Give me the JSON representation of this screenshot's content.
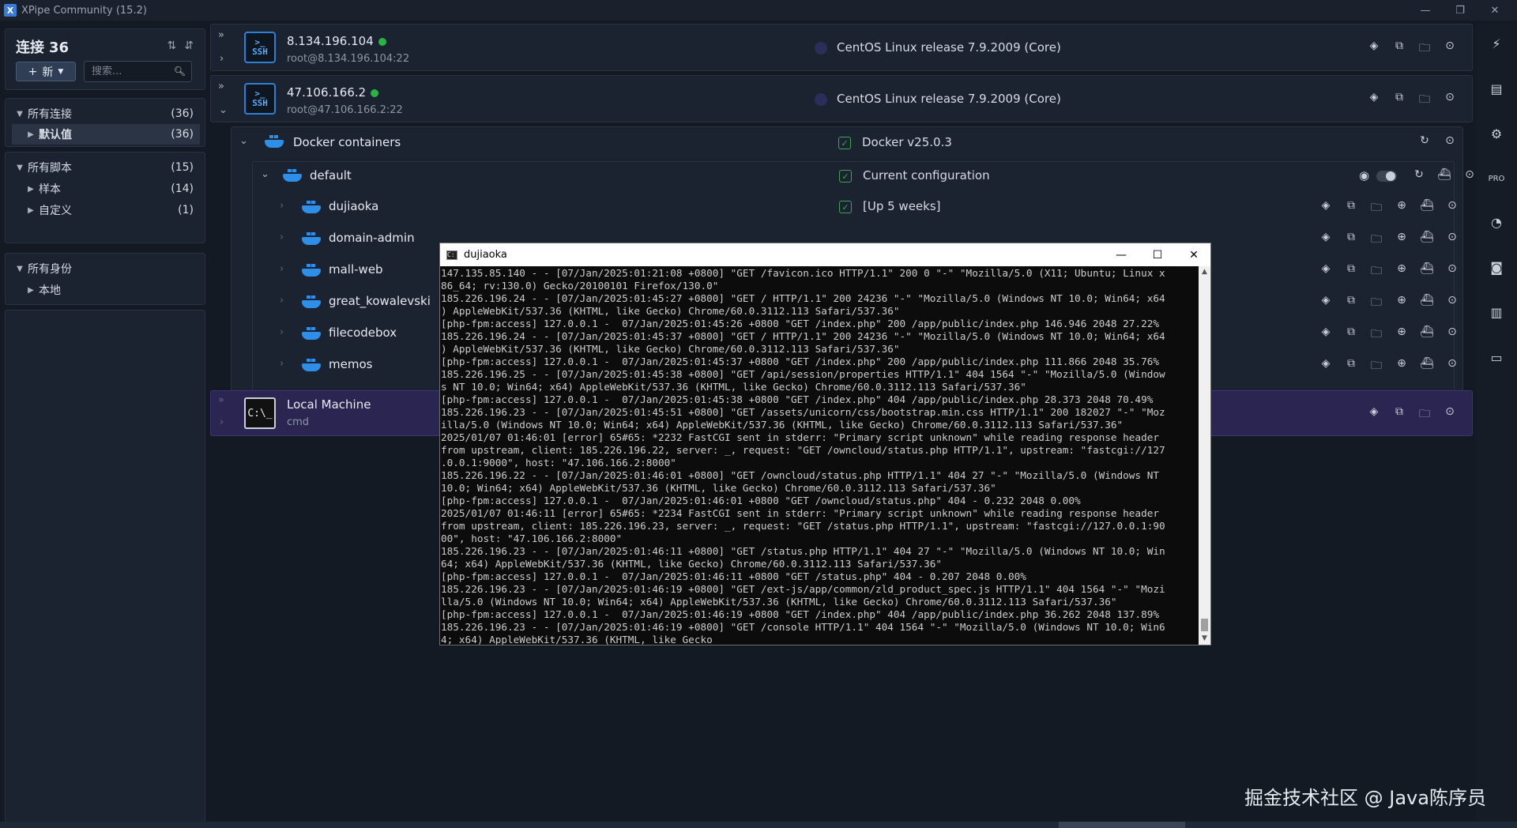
{
  "window": {
    "title": "XPipe Community (15.2)"
  },
  "sidebar": {
    "heading": "连接",
    "count": "36",
    "new_button": "新",
    "search_placeholder": "搜索...",
    "groups": [
      {
        "label": "所有连接",
        "count": "(36)",
        "children": [
          {
            "label": "默认值",
            "count": "(36)"
          }
        ]
      },
      {
        "label": "所有脚本",
        "count": "(15)",
        "children": [
          {
            "label": "样本",
            "count": "(14)"
          },
          {
            "label": "自定义",
            "count": "(1)"
          }
        ]
      },
      {
        "label": "所有身份",
        "count": "",
        "children": [
          {
            "label": "本地",
            "count": ""
          }
        ]
      }
    ]
  },
  "connections": {
    "host1": {
      "name": "8.134.196.104",
      "user": "root@8.134.196.104:22",
      "os": "CentOS Linux release 7.9.2009 (Core)"
    },
    "host2": {
      "name": "47.106.166.2",
      "user": "root@47.106.166.2:22",
      "os": "CentOS Linux release 7.9.2009 (Core)"
    },
    "docker": {
      "name": "Docker containers",
      "version": "Docker v25.0.3"
    },
    "default": {
      "name": "default",
      "status": "Current configuration"
    },
    "containers": [
      {
        "name": "dujiaoka",
        "status": "[Up 5 weeks]"
      },
      {
        "name": "domain-admin",
        "status": ""
      },
      {
        "name": "mall-web",
        "status": ""
      },
      {
        "name": "great_kowalevski",
        "status": ""
      },
      {
        "name": "filecodebox",
        "status": ""
      },
      {
        "name": "memos",
        "status": ""
      }
    ],
    "local": {
      "name": "Local Machine",
      "sub": "cmd"
    }
  },
  "terminal": {
    "title": "dujiaoka",
    "lines": [
      "147.135.85.140 - - [07/Jan/2025:01:21:08 +0800] \"GET /favicon.ico HTTP/1.1\" 200 0 \"-\" \"Mozilla/5.0 (X11; Ubuntu; Linux x",
      "86_64; rv:130.0) Gecko/20100101 Firefox/130.0\"",
      "185.226.196.24 - - [07/Jan/2025:01:45:27 +0800] \"GET / HTTP/1.1\" 200 24236 \"-\" \"Mozilla/5.0 (Windows NT 10.0; Win64; x64",
      ") AppleWebKit/537.36 (KHTML, like Gecko) Chrome/60.0.3112.113 Safari/537.36\"",
      "[php-fpm:access] 127.0.0.1 -  07/Jan/2025:01:45:26 +0800 \"GET /index.php\" 200 /app/public/index.php 146.946 2048 27.22%",
      "185.226.196.24 - - [07/Jan/2025:01:45:37 +0800] \"GET / HTTP/1.1\" 200 24236 \"-\" \"Mozilla/5.0 (Windows NT 10.0; Win64; x64",
      ") AppleWebKit/537.36 (KHTML, like Gecko) Chrome/60.0.3112.113 Safari/537.36\"",
      "[php-fpm:access] 127.0.0.1 -  07/Jan/2025:01:45:37 +0800 \"GET /index.php\" 200 /app/public/index.php 111.866 2048 35.76%",
      "185.226.196.25 - - [07/Jan/2025:01:45:38 +0800] \"GET /api/session/properties HTTP/1.1\" 404 1564 \"-\" \"Mozilla/5.0 (Window",
      "s NT 10.0; Win64; x64) AppleWebKit/537.36 (KHTML, like Gecko) Chrome/60.0.3112.113 Safari/537.36\"",
      "[php-fpm:access] 127.0.0.1 -  07/Jan/2025:01:45:38 +0800 \"GET /index.php\" 404 /app/public/index.php 28.373 2048 70.49%",
      "185.226.196.23 - - [07/Jan/2025:01:45:51 +0800] \"GET /assets/unicorn/css/bootstrap.min.css HTTP/1.1\" 200 182027 \"-\" \"Moz",
      "illa/5.0 (Windows NT 10.0; Win64; x64) AppleWebKit/537.36 (KHTML, like Gecko) Chrome/60.0.3112.113 Safari/537.36\"",
      "2025/01/07 01:46:01 [error] 65#65: *2232 FastCGI sent in stderr: \"Primary script unknown\" while reading response header",
      "from upstream, client: 185.226.196.22, server: _, request: \"GET /owncloud/status.php HTTP/1.1\", upstream: \"fastcgi://127",
      ".0.0.1:9000\", host: \"47.106.166.2:8000\"",
      "185.226.196.22 - - [07/Jan/2025:01:46:01 +0800] \"GET /owncloud/status.php HTTP/1.1\" 404 27 \"-\" \"Mozilla/5.0 (Windows NT",
      "10.0; Win64; x64) AppleWebKit/537.36 (KHTML, like Gecko) Chrome/60.0.3112.113 Safari/537.36\"",
      "[php-fpm:access] 127.0.0.1 -  07/Jan/2025:01:46:01 +0800 \"GET /owncloud/status.php\" 404 - 0.232 2048 0.00%",
      "2025/01/07 01:46:11 [error] 65#65: *2234 FastCGI sent in stderr: \"Primary script unknown\" while reading response header",
      "from upstream, client: 185.226.196.23, server: _, request: \"GET /status.php HTTP/1.1\", upstream: \"fastcgi://127.0.0.1:90",
      "00\", host: \"47.106.166.2:8000\"",
      "185.226.196.23 - - [07/Jan/2025:01:46:11 +0800] \"GET /status.php HTTP/1.1\" 404 27 \"-\" \"Mozilla/5.0 (Windows NT 10.0; Win",
      "64; x64) AppleWebKit/537.36 (KHTML, like Gecko) Chrome/60.0.3112.113 Safari/537.36\"",
      "[php-fpm:access] 127.0.0.1 -  07/Jan/2025:01:46:11 +0800 \"GET /status.php\" 404 - 0.207 2048 0.00%",
      "185.226.196.23 - - [07/Jan/2025:01:46:19 +0800] \"GET /ext-js/app/common/zld_product_spec.js HTTP/1.1\" 404 1564 \"-\" \"Mozi",
      "lla/5.0 (Windows NT 10.0; Win64; x64) AppleWebKit/537.36 (KHTML, like Gecko) Chrome/60.0.3112.113 Safari/537.36\"",
      "[php-fpm:access] 127.0.0.1 -  07/Jan/2025:01:46:19 +0800 \"GET /index.php\" 404 /app/public/index.php 36.262 2048 137.89%",
      "185.226.196.23 - - [07/Jan/2025:01:46:19 +0800] \"GET /console HTTP/1.1\" 404 1564 \"-\" \"Mozilla/5.0 (Windows NT 10.0; Win6",
      "4; x64) AppleWebKit/537.36 (KHTML, like Gecko_"
    ]
  },
  "watermark": "掘金技术社区 @ Java陈序员",
  "colors": {
    "accent": "#2f7fd6",
    "online": "#28b443",
    "local_row": "#2b2552"
  }
}
